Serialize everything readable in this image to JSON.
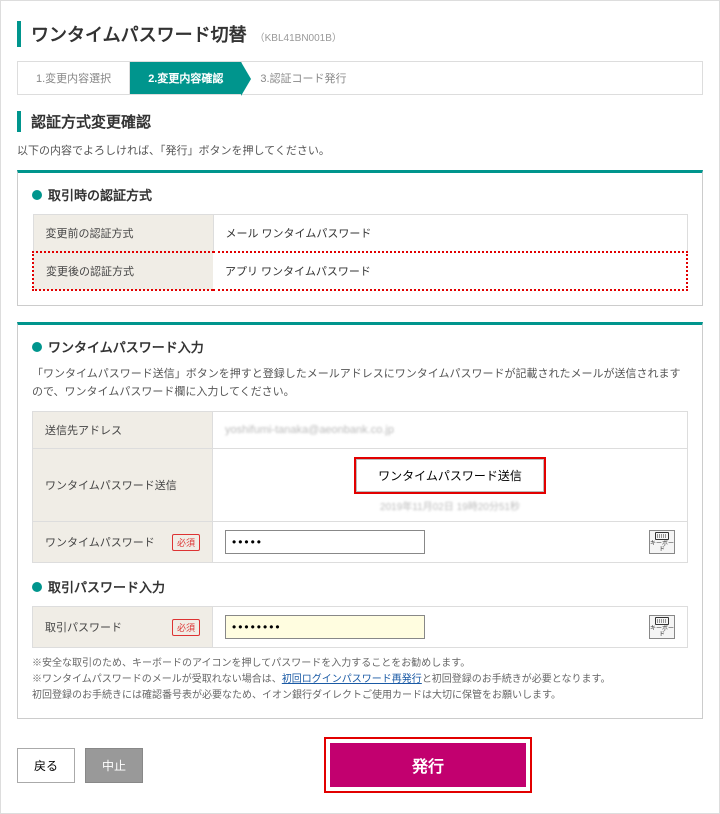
{
  "page": {
    "title": "ワンタイムパスワード切替",
    "code": "（KBL41BN001B）"
  },
  "steps": {
    "s1": "1.変更内容選択",
    "s2": "2.変更内容確認",
    "s3": "3.認証コード発行"
  },
  "section_title": "認証方式変更確認",
  "intro": "以下の内容でよろしければ、「発行」ボタンを押してください。",
  "auth_method": {
    "heading": "取引時の認証方式",
    "before_label": "変更前の認証方式",
    "before_value": "メール ワンタイムパスワード",
    "after_label": "変更後の認証方式",
    "after_value": "アプリ ワンタイムパスワード"
  },
  "otp": {
    "heading": "ワンタイムパスワード入力",
    "desc": "「ワンタイムパスワード送信」ボタンを押すと登録したメールアドレスにワンタイムパスワードが記載されたメールが送信されますので、ワンタイムパスワード欄に入力してください。",
    "address_label": "送信先アドレス",
    "send_label": "ワンタイムパスワード送信",
    "send_btn": "ワンタイムパスワード送信",
    "field_label": "ワンタイムパスワード",
    "value": "•••••",
    "kbd_label": "キーボード"
  },
  "txn": {
    "heading": "取引パスワード入力",
    "label": "取引パスワード",
    "value": "••••••••",
    "kbd_label": "キーボード"
  },
  "required": "必須",
  "notes": {
    "n1": "※安全な取引のため、キーボードのアイコンを押してパスワードを入力することをお勧めします。",
    "n2a": "※ワンタイムパスワードのメールが受取れない場合は、",
    "n2link": "初回ログインパスワード再発行",
    "n2b": "と初回登録のお手続きが必要となります。",
    "n3": "初回登録のお手続きには確認番号表が必要なため、イオン銀行ダイレクトご使用カードは大切に保管をお願いします。"
  },
  "actions": {
    "back": "戻る",
    "cancel": "中止",
    "submit": "発行"
  }
}
